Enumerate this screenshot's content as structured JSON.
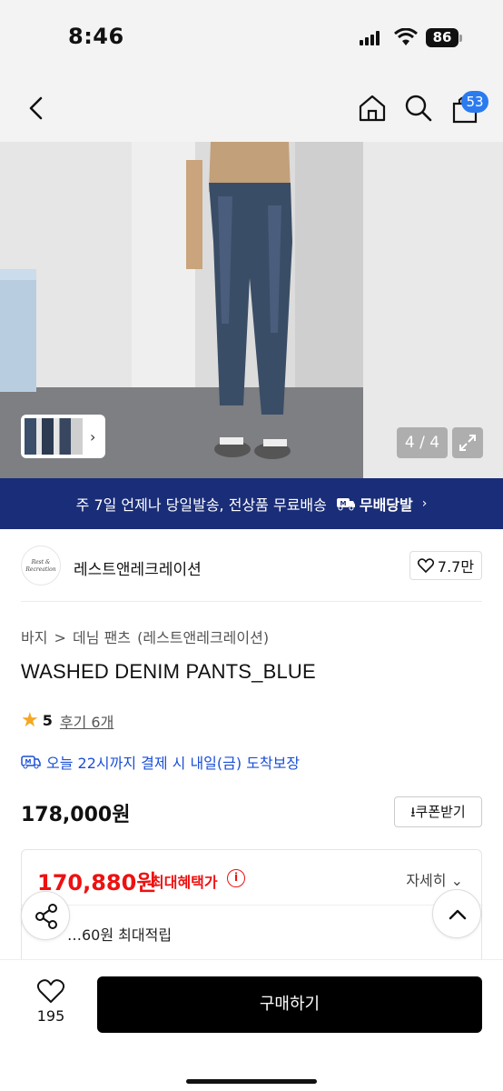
{
  "status": {
    "time": "8:46",
    "battery": "86"
  },
  "nav": {
    "cart_count": "53"
  },
  "gallery": {
    "counter": "4 / 4"
  },
  "banner": {
    "text": "주 7일 언제나 당일발송, 전상품 무료배송",
    "brand": "무배당발",
    "chevron": "›"
  },
  "brand": {
    "name": "레스트앤레크레이션",
    "logo_text": "Rest & Recreation",
    "likes": "7.7만"
  },
  "breadcrumb": [
    "바지",
    ">",
    "데님 팬츠",
    "(레스트앤레크레이션)"
  ],
  "product": {
    "title": "WASHED DENIM PANTS_BLUE",
    "rating": "5",
    "reviews": "후기 6개",
    "delivery": "오늘 22시까지 결제 시 내일(금) 도착보장",
    "price": "178,000원",
    "coupon": "쿠폰받기"
  },
  "benefit": {
    "best_price": "170,880원",
    "best_price_label": "최대혜택가",
    "detail": "자세히",
    "points": "…60원 최대적립"
  },
  "bottom": {
    "wish_count": "195",
    "buy": "구매하기"
  },
  "colors": {
    "banner": "#1a2d78",
    "accent_red": "#e11111",
    "link_blue": "#1a4fd6",
    "badge": "#2a7bf0"
  }
}
